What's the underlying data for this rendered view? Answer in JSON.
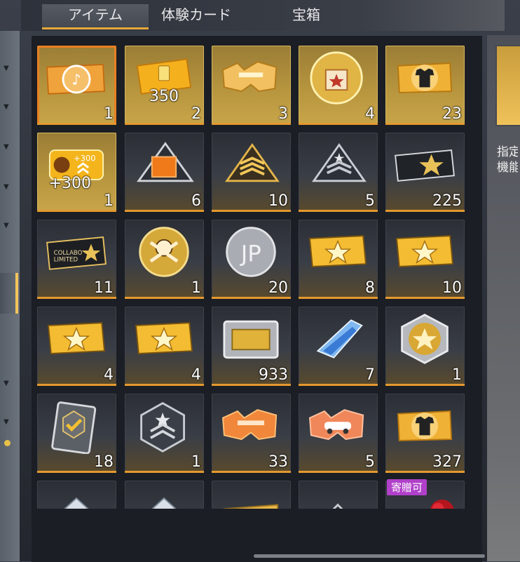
{
  "tabs": [
    {
      "label": "アイテム",
      "active": true
    },
    {
      "label": "体験カード"
    },
    {
      "label": "宝箱"
    }
  ],
  "items": [
    {
      "icon": "music-ticket-icon",
      "count": "1",
      "gold": true,
      "selected": true
    },
    {
      "icon": "coin-ticket-350-icon",
      "count": "2",
      "gold": true,
      "amount": "350"
    },
    {
      "icon": "gun-puzzle-ticket-icon",
      "count": "3",
      "gold": true
    },
    {
      "icon": "shop-bag-coin-icon",
      "count": "4",
      "gold": true
    },
    {
      "icon": "tshirt-ticket-icon",
      "count": "23",
      "gold": true
    },
    {
      "icon": "team-exp-card-icon",
      "count": "1",
      "gold": true,
      "amount": "+300"
    },
    {
      "icon": "orange-crate-rank-icon",
      "count": "6"
    },
    {
      "icon": "gold-stripes-rank-icon",
      "count": "10"
    },
    {
      "icon": "silver-rank-icon",
      "count": "5"
    },
    {
      "icon": "star-ticket-card-icon",
      "count": "225"
    },
    {
      "icon": "collabo-limited-ticket-icon",
      "count": "11",
      "text": "COLLABO LIMITED"
    },
    {
      "icon": "skull-gold-coin-icon",
      "count": "1"
    },
    {
      "icon": "silver-jp-coin-icon",
      "count": "20"
    },
    {
      "icon": "gold-star-ticket-icon",
      "count": "8"
    },
    {
      "icon": "gold-star-ticket-icon",
      "count": "10"
    },
    {
      "icon": "gold-star-ticket-icon",
      "count": "4"
    },
    {
      "icon": "gold-star-ticket-icon",
      "count": "4"
    },
    {
      "icon": "metal-frame-plate-icon",
      "count": "933"
    },
    {
      "icon": "blue-crystal-icon",
      "count": "7"
    },
    {
      "icon": "star-emblem-badge-icon",
      "count": "1"
    },
    {
      "icon": "check-card-icon",
      "count": "18"
    },
    {
      "icon": "hexagon-rank-badge-icon",
      "count": "1"
    },
    {
      "icon": "orange-gun-puzzle-icon",
      "count": "33"
    },
    {
      "icon": "car-puzzle-ticket-icon",
      "count": "5"
    },
    {
      "icon": "tshirt-ticket-icon",
      "count": "327"
    },
    {
      "icon": "partial-badge-icon",
      "count": ""
    },
    {
      "icon": "partial-badge-icon",
      "count": ""
    },
    {
      "icon": "partial-ticket-icon",
      "count": ""
    },
    {
      "icon": "partial-rank-icon",
      "count": ""
    },
    {
      "icon": "rose-icon",
      "count": "",
      "badge": "寄贈可"
    }
  ],
  "detail": {
    "text_line1": "指定",
    "text_line2": "機能"
  },
  "colors": {
    "accent": "#e6a83a",
    "selected": "#e98022",
    "gift_badge": "#b040c9"
  }
}
